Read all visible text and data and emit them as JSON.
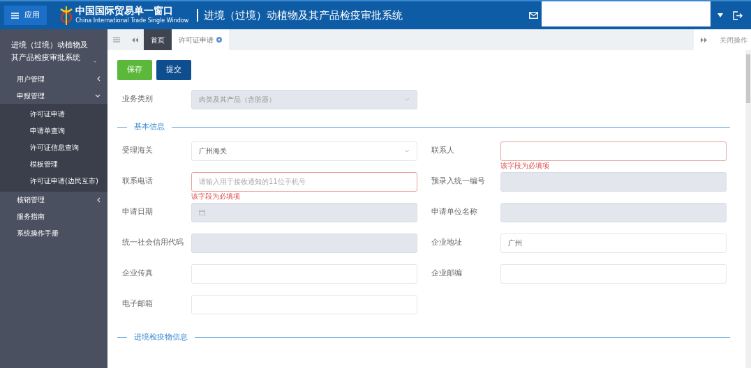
{
  "header": {
    "menu_button": "应用",
    "logo_title": "中国国际贸易单一窗口",
    "logo_subtitle": "China International Trade Single Window",
    "system_title": "进境（过境）动植物及其产品检疫审批系统"
  },
  "sidebar": {
    "title": "进境（过境）动植物及其产品检疫审批系统",
    "items": [
      {
        "label": "用户管理",
        "kind": "group",
        "expanded": false
      },
      {
        "label": "申报管理",
        "kind": "group",
        "expanded": true,
        "children": [
          {
            "label": "许可证申请"
          },
          {
            "label": "申请单查询"
          },
          {
            "label": "许可证信息查询"
          },
          {
            "label": "模板管理"
          },
          {
            "label": "许可证申请(边民互市)"
          }
        ]
      },
      {
        "label": "核销管理",
        "kind": "group",
        "expanded": false
      },
      {
        "label": "服务指南",
        "kind": "link"
      },
      {
        "label": "系统操作手册",
        "kind": "link"
      }
    ]
  },
  "tabs": [
    {
      "label": "首页",
      "selected": false,
      "closable": false
    },
    {
      "label": "许可证申请",
      "selected": true,
      "closable": true
    }
  ],
  "close_operations": "关闭操作",
  "buttons": [
    {
      "label": "保存",
      "kind": "save"
    },
    {
      "label": "提交",
      "kind": "submit"
    }
  ],
  "business_type": {
    "label": "业务类别",
    "value": "肉类及其产品（含脏器）",
    "disabled": true
  },
  "sections": [
    {
      "title": "基本信息",
      "fields": [
        {
          "label": "受理海关",
          "kind": "select",
          "value": "广州海关",
          "disabled": false
        },
        {
          "label": "联系人",
          "kind": "text",
          "disabled": false,
          "error": "该字段为必填项"
        },
        {
          "label": "联系电话",
          "kind": "text",
          "placeholder": "请输入用于接收通知的11位手机号",
          "disabled": false,
          "error": "该字段为必填项"
        },
        {
          "label": "预录入统一编号",
          "kind": "text",
          "disabled": true
        },
        {
          "label": "申请日期",
          "kind": "date",
          "disabled": true
        },
        {
          "label": "申请单位名称",
          "kind": "text",
          "disabled": true
        },
        {
          "label": "统一社会信用代码",
          "kind": "text",
          "disabled": true
        },
        {
          "label": "企业地址",
          "kind": "text",
          "value": "广州",
          "disabled": false
        },
        {
          "label": "企业传真",
          "kind": "text",
          "disabled": false
        },
        {
          "label": "企业邮编",
          "kind": "text",
          "disabled": false
        },
        {
          "label": "电子邮箱",
          "kind": "text",
          "disabled": false
        }
      ]
    },
    {
      "title": "进境检疫物信息"
    }
  ]
}
